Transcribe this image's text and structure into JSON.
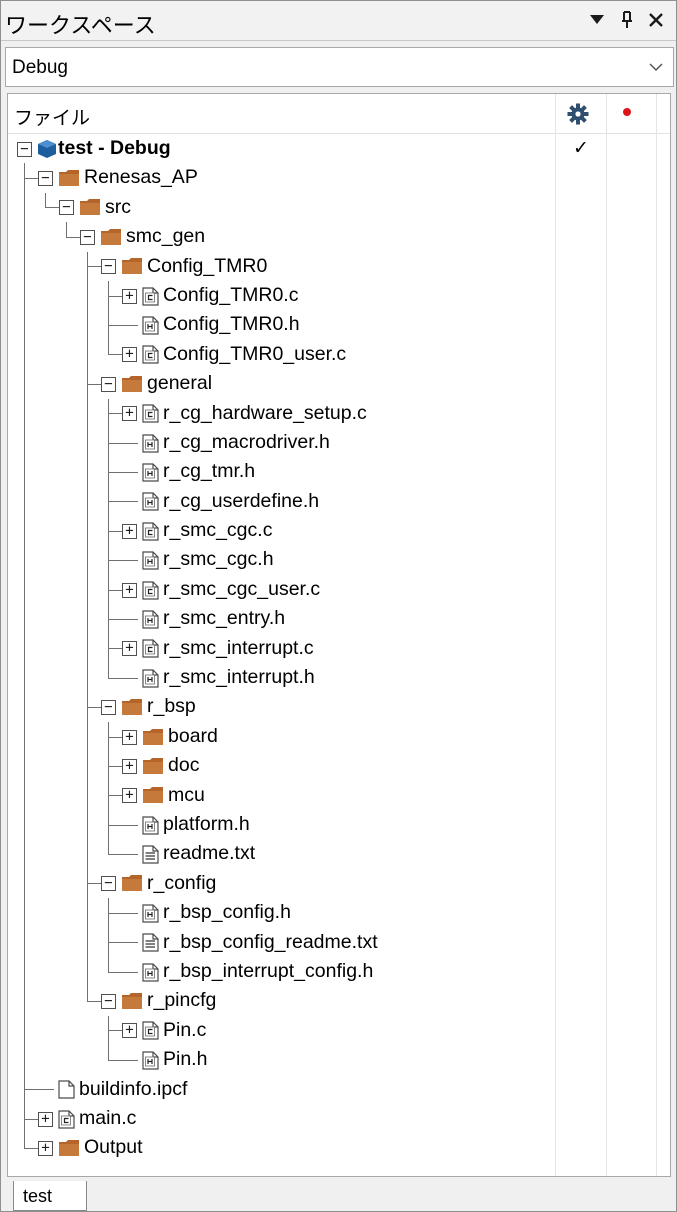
{
  "panel": {
    "title": "ワークスペース",
    "dropdown_icon": "triangle-down-icon",
    "pin_icon": "pin-icon",
    "close_icon": "close-icon"
  },
  "config": {
    "selected": "Debug",
    "arrow_icon": "chevron-down-icon"
  },
  "tree_header": {
    "file_label": "ファイル",
    "build_icon": "gear-icon",
    "debug_icon": "red-dot-icon",
    "colors": {
      "debug_dot": "#e0151a",
      "folder": "#b5652a",
      "project": "#1d5e9c"
    }
  },
  "tree": [
    {
      "label": "test - Debug",
      "depth": 0,
      "type": "project",
      "expander": "minus",
      "bold": true,
      "check": "✓"
    },
    {
      "label": "Renesas_AP",
      "depth": 1,
      "type": "folder",
      "expander": "minus"
    },
    {
      "label": "src",
      "depth": 2,
      "type": "folder",
      "expander": "minus"
    },
    {
      "label": "smc_gen",
      "depth": 3,
      "type": "folder",
      "expander": "minus"
    },
    {
      "label": "Config_TMR0",
      "depth": 4,
      "type": "folder",
      "expander": "minus"
    },
    {
      "label": "Config_TMR0.c",
      "depth": 5,
      "type": "c-file",
      "expander": "plus"
    },
    {
      "label": "Config_TMR0.h",
      "depth": 5,
      "type": "h-file",
      "expander": "none"
    },
    {
      "label": "Config_TMR0_user.c",
      "depth": 5,
      "type": "c-file",
      "expander": "plus"
    },
    {
      "label": "general",
      "depth": 4,
      "type": "folder",
      "expander": "minus"
    },
    {
      "label": "r_cg_hardware_setup.c",
      "depth": 5,
      "type": "c-file",
      "expander": "plus"
    },
    {
      "label": "r_cg_macrodriver.h",
      "depth": 5,
      "type": "h-file",
      "expander": "none"
    },
    {
      "label": "r_cg_tmr.h",
      "depth": 5,
      "type": "h-file",
      "expander": "none"
    },
    {
      "label": "r_cg_userdefine.h",
      "depth": 5,
      "type": "h-file",
      "expander": "none"
    },
    {
      "label": "r_smc_cgc.c",
      "depth": 5,
      "type": "c-file",
      "expander": "plus"
    },
    {
      "label": "r_smc_cgc.h",
      "depth": 5,
      "type": "h-file",
      "expander": "none"
    },
    {
      "label": "r_smc_cgc_user.c",
      "depth": 5,
      "type": "c-file",
      "expander": "plus"
    },
    {
      "label": "r_smc_entry.h",
      "depth": 5,
      "type": "h-file",
      "expander": "none"
    },
    {
      "label": "r_smc_interrupt.c",
      "depth": 5,
      "type": "c-file",
      "expander": "plus"
    },
    {
      "label": "r_smc_interrupt.h",
      "depth": 5,
      "type": "h-file",
      "expander": "none"
    },
    {
      "label": "r_bsp",
      "depth": 4,
      "type": "folder",
      "expander": "minus"
    },
    {
      "label": "board",
      "depth": 5,
      "type": "folder",
      "expander": "plus"
    },
    {
      "label": "doc",
      "depth": 5,
      "type": "folder",
      "expander": "plus"
    },
    {
      "label": "mcu",
      "depth": 5,
      "type": "folder",
      "expander": "plus"
    },
    {
      "label": "platform.h",
      "depth": 5,
      "type": "h-file",
      "expander": "none"
    },
    {
      "label": "readme.txt",
      "depth": 5,
      "type": "txt-file",
      "expander": "none"
    },
    {
      "label": "r_config",
      "depth": 4,
      "type": "folder",
      "expander": "minus"
    },
    {
      "label": "r_bsp_config.h",
      "depth": 5,
      "type": "h-file",
      "expander": "none"
    },
    {
      "label": "r_bsp_config_readme.txt",
      "depth": 5,
      "type": "txt-file",
      "expander": "none"
    },
    {
      "label": "r_bsp_interrupt_config.h",
      "depth": 5,
      "type": "h-file",
      "expander": "none"
    },
    {
      "label": "r_pincfg",
      "depth": 4,
      "type": "folder",
      "expander": "minus"
    },
    {
      "label": "Pin.c",
      "depth": 5,
      "type": "c-file",
      "expander": "plus"
    },
    {
      "label": "Pin.h",
      "depth": 5,
      "type": "h-file",
      "expander": "none"
    },
    {
      "label": "buildinfo.ipcf",
      "depth": 1,
      "type": "blank-file",
      "expander": "none"
    },
    {
      "label": "main.c",
      "depth": 1,
      "type": "c-file",
      "expander": "plus"
    },
    {
      "label": "Output",
      "depth": 1,
      "type": "folder",
      "expander": "plus"
    }
  ],
  "bottom_tab": {
    "label": "test"
  }
}
